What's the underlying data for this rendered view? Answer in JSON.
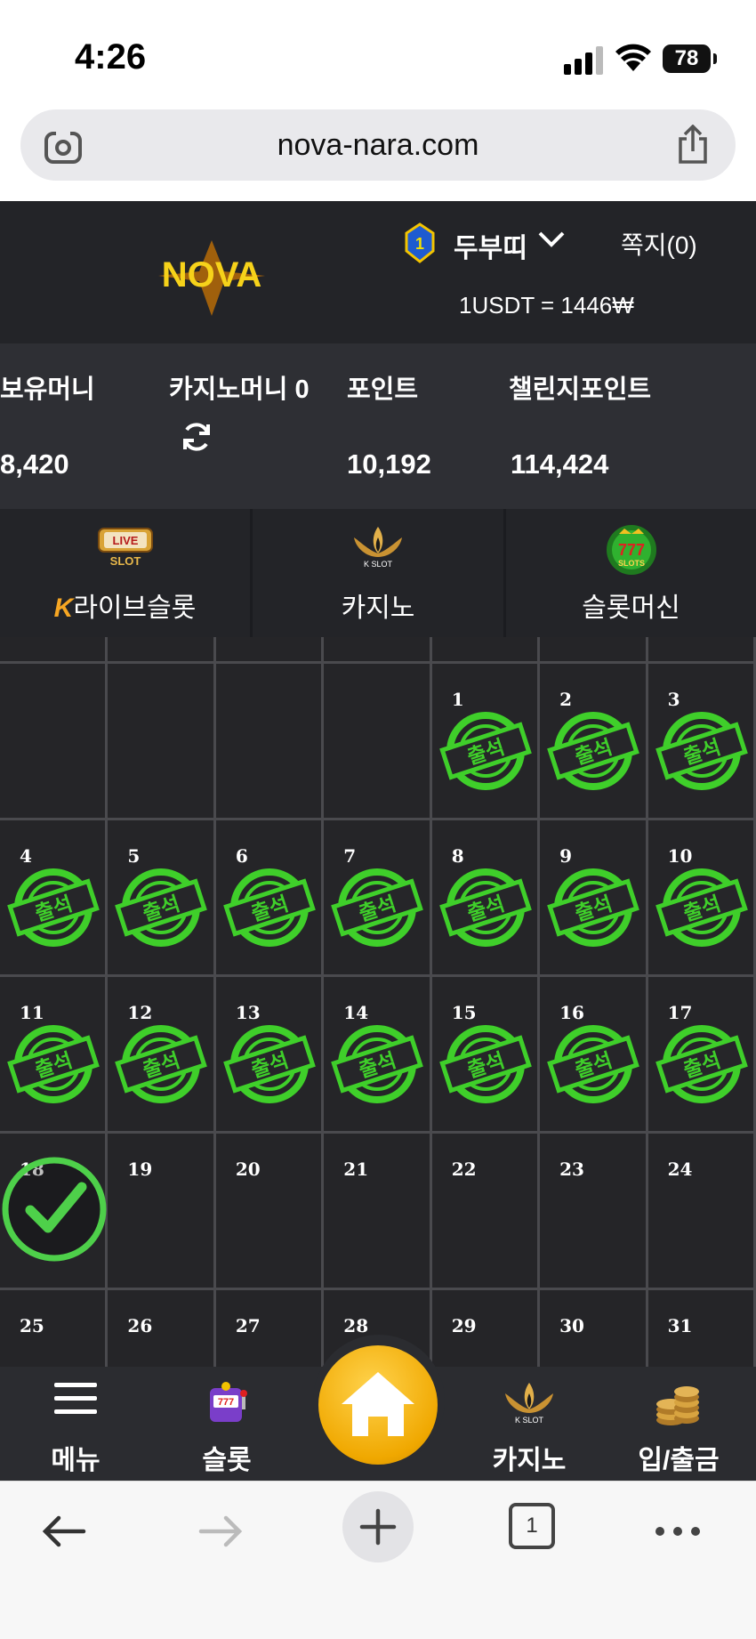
{
  "status": {
    "time": "4:26",
    "battery": "78"
  },
  "browser": {
    "url": "nova-nara.com",
    "tab_count": "1"
  },
  "header": {
    "logo_text": "NOVA",
    "level": "1",
    "username": "두부띠",
    "messages": "쪽지(0)",
    "rate": "1USDT = 1446₩"
  },
  "balance": {
    "items": [
      {
        "label": "보유머니",
        "value": "8,420"
      },
      {
        "label": "카지노머니 0",
        "value": ""
      },
      {
        "label": "포인트",
        "value": "10,192"
      },
      {
        "label": "챌린지포인트",
        "value": "114,424"
      }
    ]
  },
  "categories": [
    {
      "label": "라이브슬롯",
      "badge": "K",
      "icon": "live-slot-icon"
    },
    {
      "label": "카지노",
      "icon": "k-slot-lotus-icon"
    },
    {
      "label": "슬롯머신",
      "icon": "777-slots-icon"
    }
  ],
  "calendar": {
    "stamp_text": "출석",
    "attended_days": [
      1,
      2,
      3,
      4,
      5,
      6,
      7,
      8,
      9,
      10,
      11,
      12,
      13,
      14,
      15,
      16,
      17
    ],
    "today": 18,
    "rows": [
      [
        "",
        "",
        "",
        "",
        "1",
        "2",
        "3"
      ],
      [
        "4",
        "5",
        "6",
        "7",
        "8",
        "9",
        "10"
      ],
      [
        "11",
        "12",
        "13",
        "14",
        "15",
        "16",
        "17"
      ],
      [
        "18",
        "19",
        "20",
        "21",
        "22",
        "23",
        "24"
      ],
      [
        "25",
        "26",
        "27",
        "28",
        "29",
        "30",
        "31"
      ]
    ]
  },
  "bottom_nav": [
    {
      "label": "메뉴",
      "icon": "hamburger-icon"
    },
    {
      "label": "슬롯",
      "icon": "slot-machine-icon"
    },
    {
      "label": "",
      "icon": "home-icon"
    },
    {
      "label": "카지노",
      "icon": "k-slot-lotus-icon"
    },
    {
      "label": "입/출금",
      "icon": "coins-icon"
    }
  ],
  "colors": {
    "stamp_green": "#3fcf2a",
    "home_gold": "#f0a800",
    "header_bg": "#232428"
  }
}
